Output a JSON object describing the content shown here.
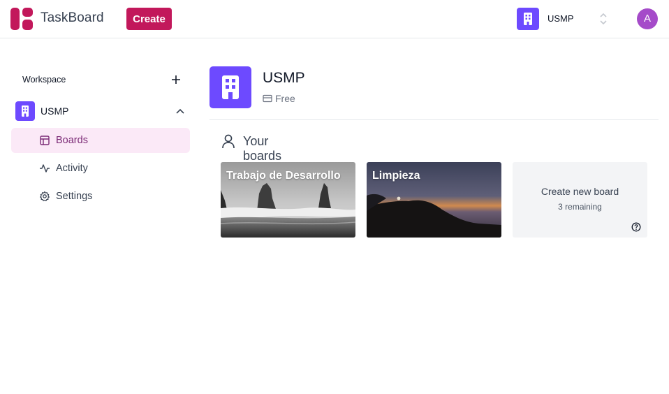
{
  "app": {
    "name": "TaskBoard",
    "create_label": "Create",
    "brand_color": "#c2185b"
  },
  "header": {
    "org_switcher": {
      "name": "USMP",
      "icon": "building-icon"
    },
    "avatar_initial": "A",
    "avatar_color": "#a54bc9"
  },
  "sidebar": {
    "workspace_label": "Workspace",
    "add_icon": "plus-icon",
    "workspace": {
      "name": "USMP",
      "icon": "building-icon",
      "expanded": true
    },
    "items": [
      {
        "label": "Boards",
        "icon": "board-layout-icon",
        "active": true
      },
      {
        "label": "Activity",
        "icon": "activity-icon",
        "active": false
      },
      {
        "label": "Settings",
        "icon": "settings-gear-icon",
        "active": false
      }
    ]
  },
  "main": {
    "org": {
      "name": "USMP",
      "plan": "Free",
      "accent": "#6d4aff"
    },
    "boards_heading": "Your boards",
    "boards": [
      {
        "title": "Trabajo de Desarrollo"
      },
      {
        "title": "Limpieza"
      }
    ],
    "new_board": {
      "label": "Create new board",
      "remaining": "3 remaining"
    }
  }
}
